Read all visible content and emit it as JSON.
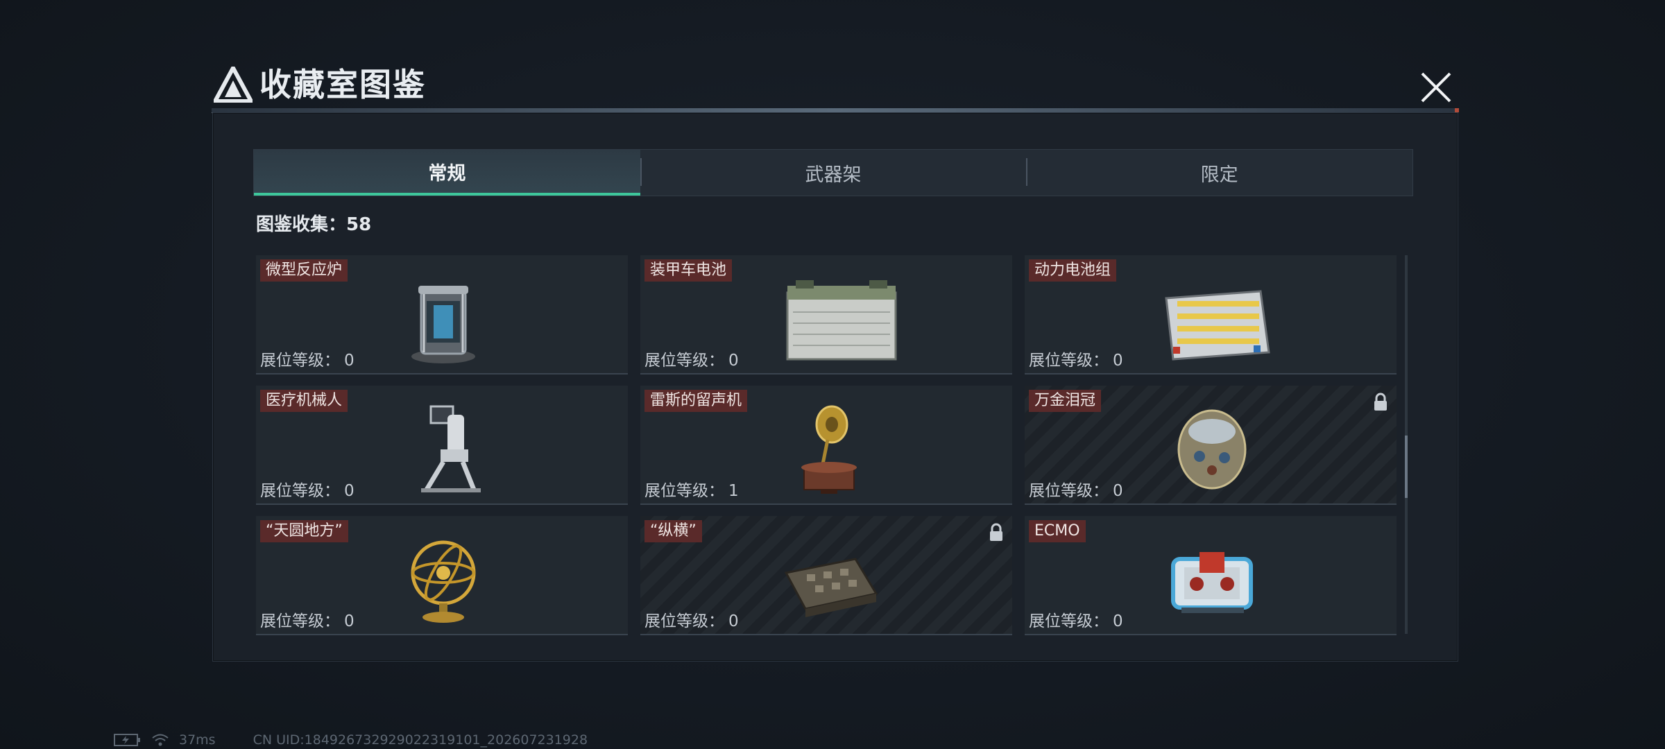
{
  "header": {
    "title": "收藏室图鉴"
  },
  "tabs": [
    {
      "label": "常规",
      "active": true
    },
    {
      "label": "武器架",
      "active": false
    },
    {
      "label": "限定",
      "active": false
    }
  ],
  "collection": {
    "text": "图鉴收集：58"
  },
  "level_label": "展位等级：",
  "items": [
    {
      "name": "微型反应炉",
      "level": "0",
      "locked": false,
      "icon": "micro-reactor-icon"
    },
    {
      "name": "装甲车电池",
      "level": "0",
      "locked": false,
      "icon": "armored-battery-icon"
    },
    {
      "name": "动力电池组",
      "level": "0",
      "locked": false,
      "icon": "power-battery-pack-icon"
    },
    {
      "name": "医疗机械人",
      "level": "0",
      "locked": false,
      "icon": "medical-robot-icon"
    },
    {
      "name": "雷斯的留声机",
      "level": "1",
      "locked": false,
      "icon": "gramophone-icon"
    },
    {
      "name": "万金泪冠",
      "level": "0",
      "locked": true,
      "icon": "jeweled-egg-icon"
    },
    {
      "name": "“天圆地方”",
      "level": "0",
      "locked": false,
      "icon": "armillary-sphere-icon"
    },
    {
      "name": "“纵横”",
      "level": "0",
      "locked": true,
      "icon": "chess-board-icon"
    },
    {
      "name": "ECMO",
      "level": "0",
      "locked": false,
      "icon": "ecmo-machine-icon"
    }
  ],
  "status": {
    "ping": "37ms",
    "uid": "CN UID:18492673292902231910​1_202607231928"
  },
  "colors": {
    "accent": "#3ec79b",
    "name_tag": "#5a2a2a",
    "background": "#141a22"
  }
}
